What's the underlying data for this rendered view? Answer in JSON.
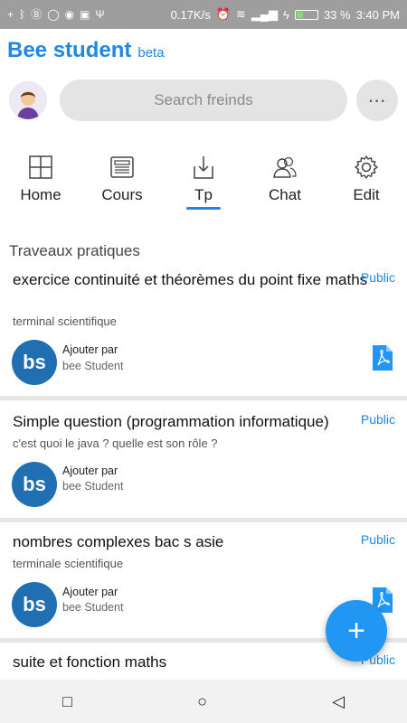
{
  "status_bar": {
    "speed": "0.17K/s",
    "battery": "33 %",
    "battery_level": 0.33,
    "time": "3:40 PM",
    "icons": [
      "plus-icon",
      "bluetooth-icon",
      "b-circle-icon",
      "chat-bubble-icon",
      "whatsapp-icon",
      "screenshot-icon",
      "usb-icon",
      "alarm-icon",
      "wifi-icon",
      "signal-icon",
      "signal-icon",
      "charging-icon"
    ]
  },
  "header": {
    "title": "Bee student",
    "badge": "beta"
  },
  "search": {
    "placeholder": "Search freinds"
  },
  "more_button": {
    "label": "⋯"
  },
  "nav": {
    "active_index": 2,
    "items": [
      {
        "label": "Home",
        "icon": "grid-icon"
      },
      {
        "label": "Cours",
        "icon": "newspaper-icon"
      },
      {
        "label": "Tp",
        "icon": "download-tray-icon"
      },
      {
        "label": "Chat",
        "icon": "people-icon"
      },
      {
        "label": "Edit",
        "icon": "gear-icon"
      }
    ]
  },
  "section": {
    "title": "Traveaux pratiques"
  },
  "cards": [
    {
      "title": "exercice continuité et théorèmes du point fixe maths",
      "visibility": "Public",
      "subtitle": "terminal scientifique",
      "logo": "bs",
      "added_by": "Ajouter par",
      "author": "bee Student",
      "has_pdf": true
    },
    {
      "title": "Simple question (programmation informatique)",
      "visibility": "Public",
      "subtitle": "c'est quoi le java ? quelle est son rôle ?",
      "logo": "bs",
      "added_by": "Ajouter par",
      "author": "bee Student",
      "has_pdf": false
    },
    {
      "title": "nombres complexes bac s asie",
      "visibility": "Public",
      "subtitle": "terminale scientifique",
      "logo": "bs",
      "added_by": "Ajouter par",
      "author": "bee Student",
      "has_pdf": true
    },
    {
      "title": "suite et fonction maths",
      "visibility": "Public"
    }
  ],
  "fab": {
    "label": "+"
  },
  "system_nav": {
    "recent": "□",
    "home": "○",
    "back": "◁"
  },
  "colors": {
    "accent": "#1e88e5",
    "fab": "#2196f3",
    "logo": "#1f6fb2",
    "pdf": "#2196f3"
  }
}
